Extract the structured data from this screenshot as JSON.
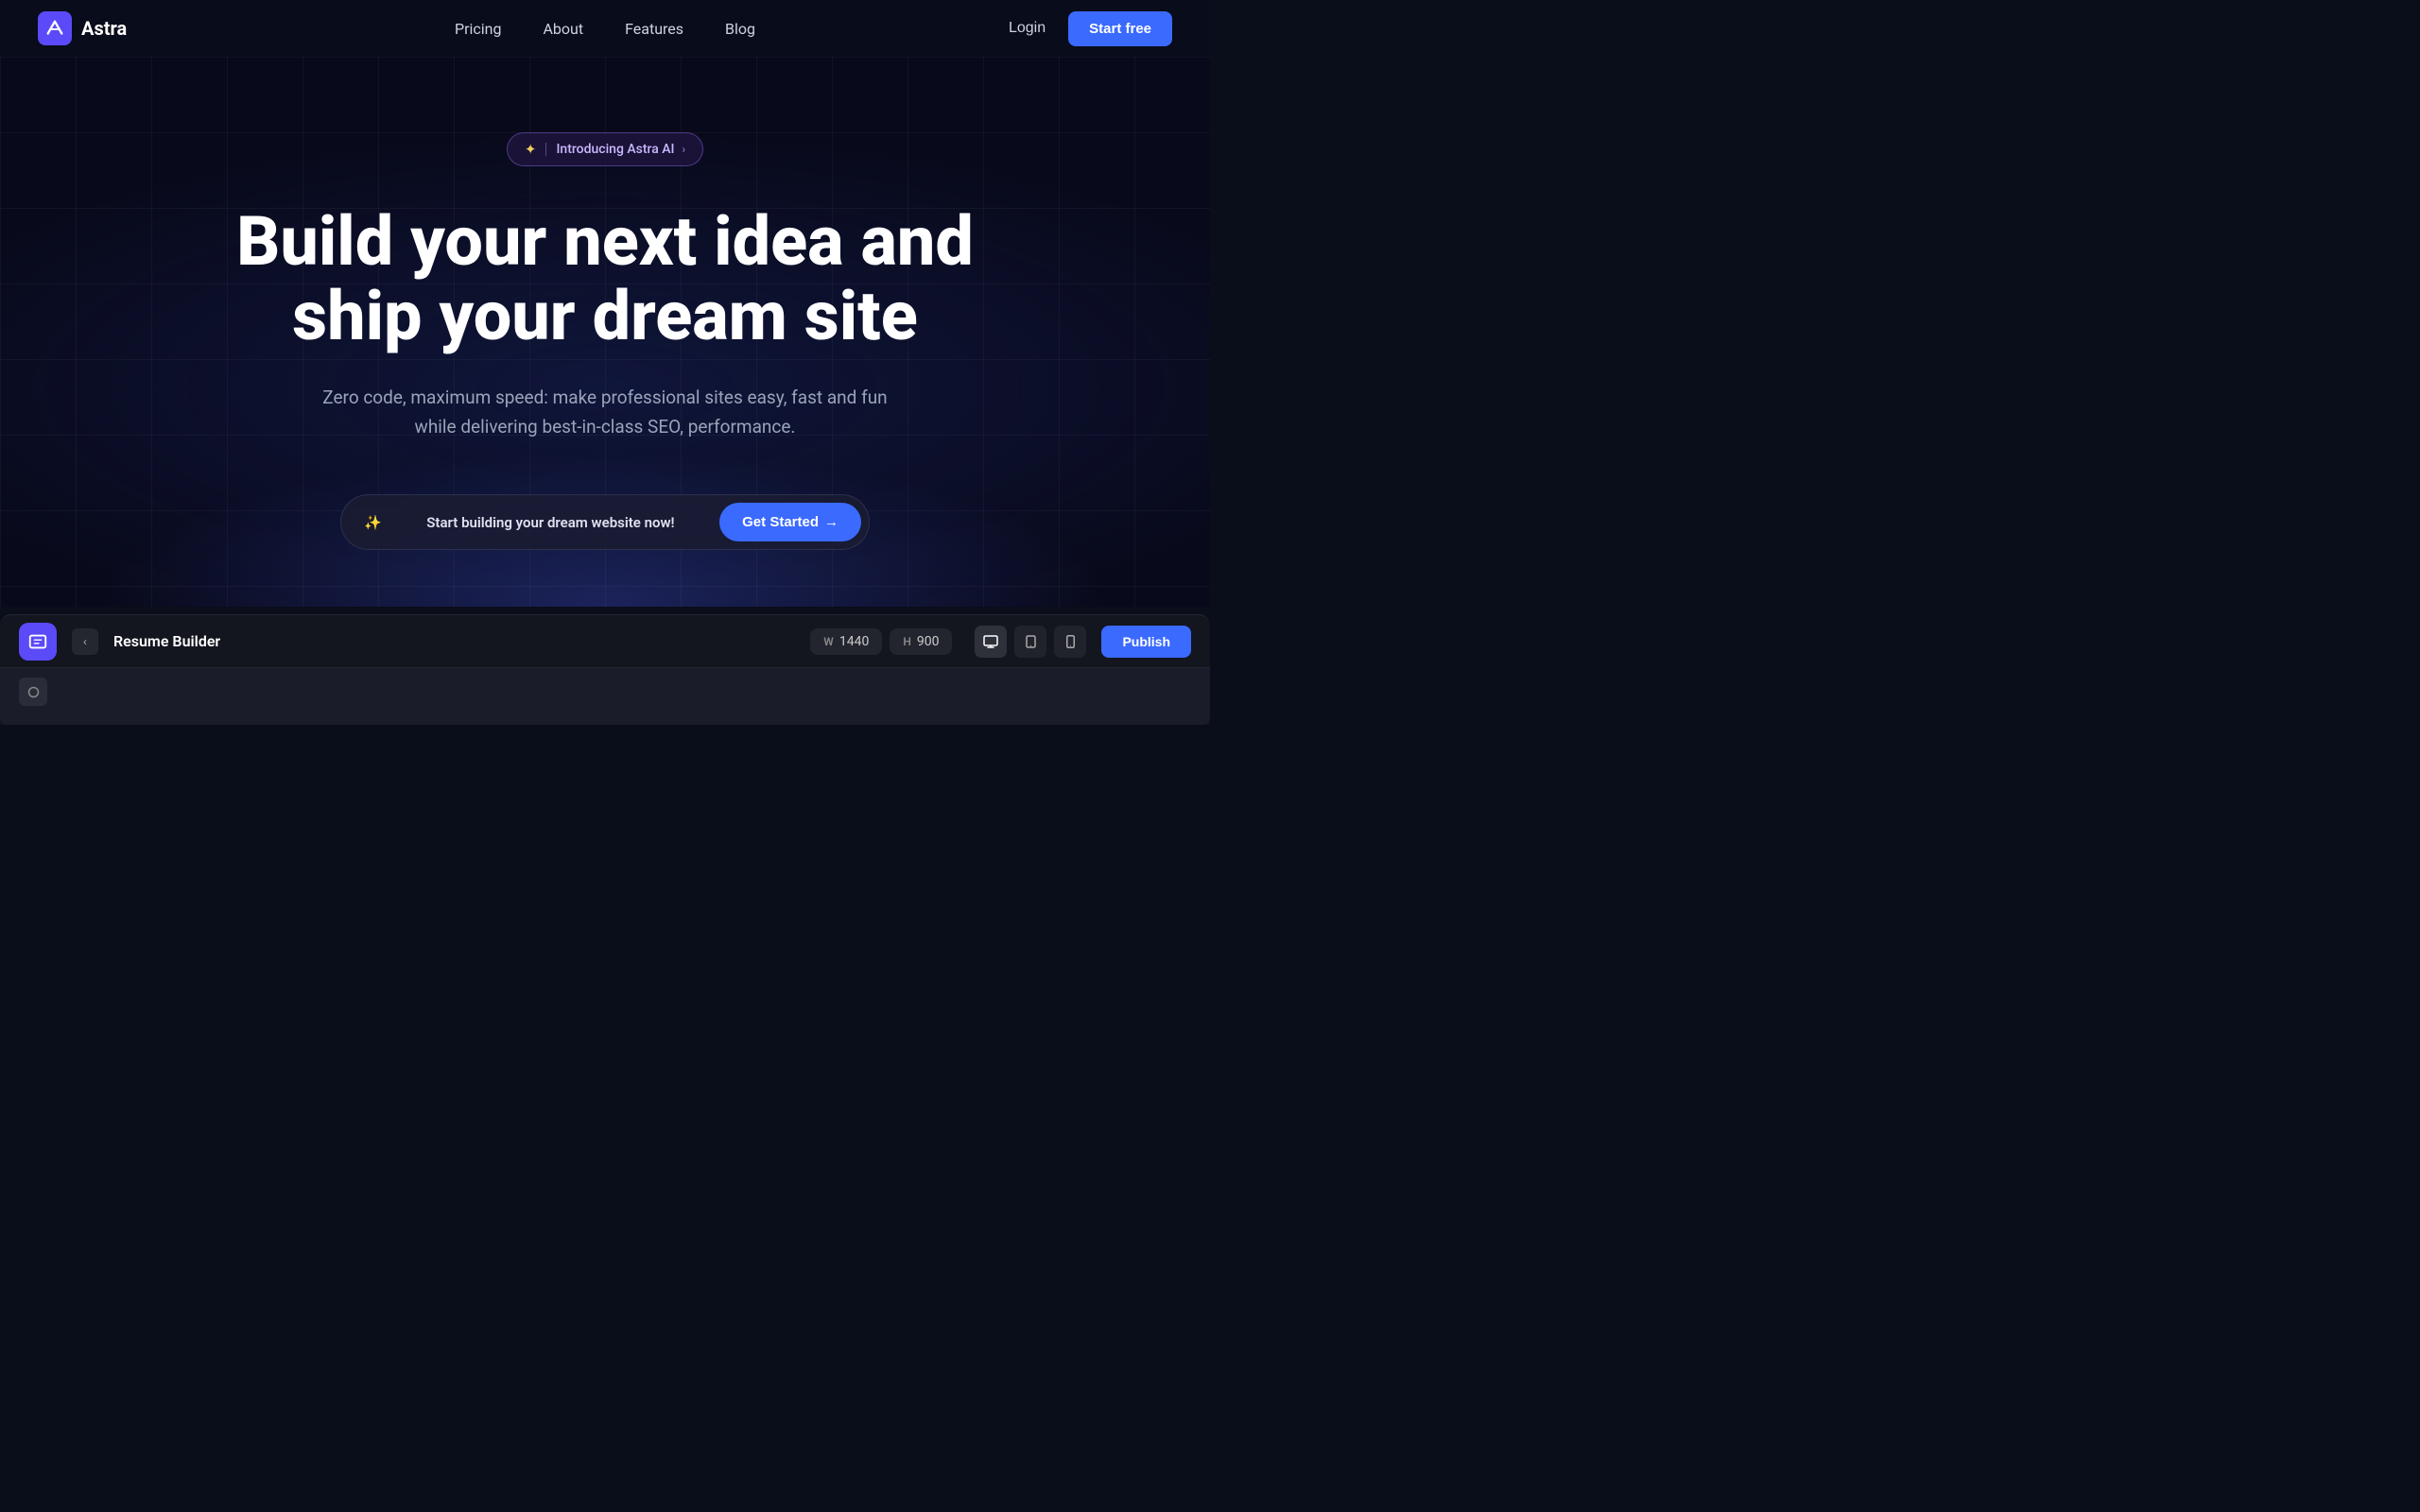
{
  "nav": {
    "logo_text": "Astra",
    "links": [
      {
        "id": "pricing",
        "label": "Pricing"
      },
      {
        "id": "about",
        "label": "About"
      },
      {
        "id": "features",
        "label": "Features"
      },
      {
        "id": "blog",
        "label": "Blog"
      }
    ],
    "login_label": "Login",
    "start_free_label": "Start free"
  },
  "hero": {
    "badge_sparkle": "✦",
    "badge_text": "Introducing Astra AI",
    "badge_chevron": "›",
    "title_line1": "Build your next idea and",
    "title_line2": "ship your dream site",
    "subtitle": "Zero code, maximum speed: make professional sites easy, fast and fun while delivering best-in-class SEO, performance.",
    "cta_sparkle": "✨",
    "cta_text": "Start building your dream website now!",
    "cta_button": "Get Started",
    "cta_arrow": "→"
  },
  "panel": {
    "title": "Resume Builder",
    "width_label": "W",
    "width_value": "1440",
    "height_label": "H",
    "height_value": "900",
    "publish_label": "Publish",
    "back_arrow": "‹",
    "view_desktop": "🖥",
    "view_tablet": "📱",
    "view_mobile": "⬛"
  }
}
